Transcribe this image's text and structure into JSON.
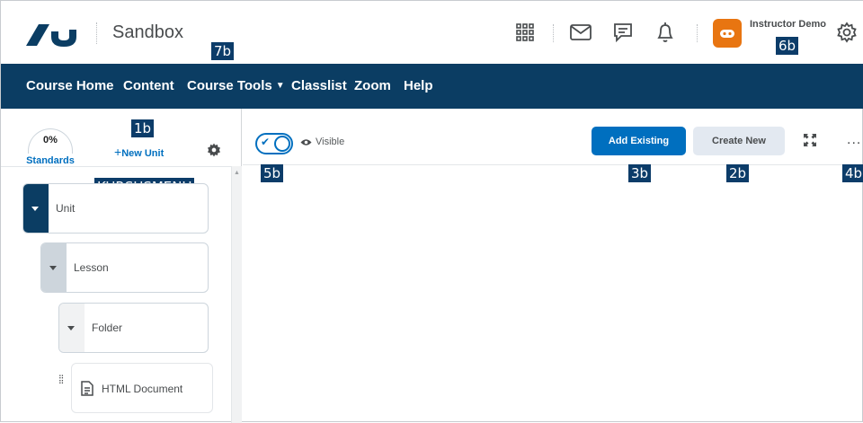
{
  "header": {
    "org_title": "Sandbox",
    "user_name": "Instructor Demo",
    "icons": [
      "waffle-icon",
      "mail-icon",
      "chat-icon",
      "bell-icon",
      "gear-icon"
    ]
  },
  "nav": {
    "items": [
      {
        "label": "Course Home"
      },
      {
        "label": "Content"
      },
      {
        "label": "Course Tools",
        "has_dropdown": true
      },
      {
        "label": "Classlist"
      },
      {
        "label": "Zoom"
      },
      {
        "label": "Help"
      }
    ]
  },
  "sidebar": {
    "standards_percent": "0%",
    "standards_label": "Standards",
    "new_unit_plus": "+",
    "new_unit_label": "New Unit",
    "tree": [
      {
        "label": "Unit"
      },
      {
        "label": "Lesson"
      },
      {
        "label": "Folder"
      },
      {
        "label": "HTML Document"
      }
    ]
  },
  "main": {
    "visible_label": "Visible",
    "add_existing_label": "Add Existing",
    "create_new_label": "Create New",
    "more_label": "..."
  },
  "badges": {
    "b1": "1b",
    "b2": "2b",
    "b3": "3b",
    "b4": "4b",
    "b5": "5b",
    "b6": "6b",
    "b7": "7b",
    "menu": "KURSUSMENU"
  },
  "colors": {
    "nav_bg": "#0b3d63",
    "primary": "#006fbf",
    "avatar": "#e87511",
    "badge_bg": "#0c3c69"
  }
}
